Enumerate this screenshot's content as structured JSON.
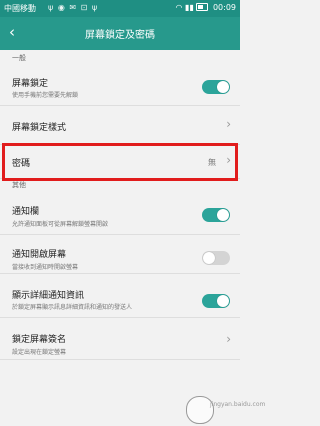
{
  "status_bar": {
    "carrier": "中國移動",
    "signal": "◁",
    "icons": "ψ ◉ ✉ ⊡ ψ",
    "right_icons": "◠ ▮▮",
    "battery_icon": "battery-icon",
    "time": "00:09"
  },
  "header": {
    "back_icon": "‹",
    "title": "屏幕鎖定及密碼"
  },
  "sections": {
    "general": "一般",
    "other": "其他"
  },
  "settings": {
    "screen_lock": {
      "title": "屏幕鎖定",
      "subtitle": "使用手機前您需要先解鎖",
      "enabled": true
    },
    "lock_style": {
      "title": "屏幕鎖定樣式"
    },
    "password": {
      "title": "密碼",
      "value": "無"
    },
    "notification_bar": {
      "title": "通知欄",
      "subtitle": "允許通知面板可從屏幕解鎖螢幕開啟",
      "enabled": true
    },
    "notification_wake": {
      "title": "通知開啟屏幕",
      "subtitle": "當接收到通知時開啟螢幕",
      "enabled": false
    },
    "show_details": {
      "title": "顯示詳細通知資訊",
      "subtitle": "於鎖定屏幕顯示訊息詳細資訊和通知的發送人",
      "enabled": true
    },
    "signature": {
      "title": "鎖定屏幕簽名",
      "subtitle": "設定出現在鎖定螢幕"
    }
  },
  "watermark": {
    "text": "jingyan.baidu.com"
  },
  "colors": {
    "accent": "#27998c",
    "highlight": "#e11c1c"
  }
}
